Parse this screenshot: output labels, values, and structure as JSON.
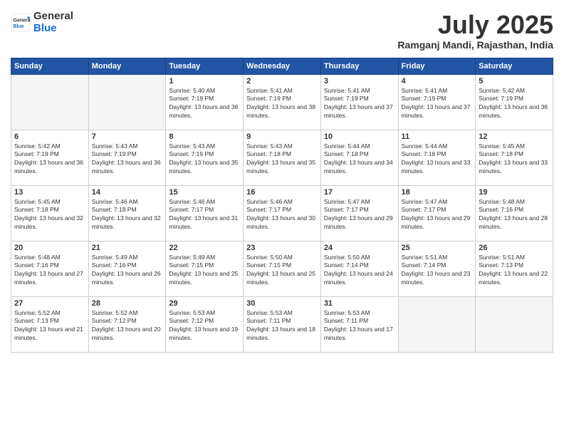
{
  "header": {
    "logo_general": "General",
    "logo_blue": "Blue",
    "month_year": "July 2025",
    "location": "Ramganj Mandi, Rajasthan, India"
  },
  "days_of_week": [
    "Sunday",
    "Monday",
    "Tuesday",
    "Wednesday",
    "Thursday",
    "Friday",
    "Saturday"
  ],
  "weeks": [
    [
      {
        "day": "",
        "info": ""
      },
      {
        "day": "",
        "info": ""
      },
      {
        "day": "1",
        "info": "Sunrise: 5:40 AM\nSunset: 7:19 PM\nDaylight: 13 hours and 38 minutes."
      },
      {
        "day": "2",
        "info": "Sunrise: 5:41 AM\nSunset: 7:19 PM\nDaylight: 13 hours and 38 minutes."
      },
      {
        "day": "3",
        "info": "Sunrise: 5:41 AM\nSunset: 7:19 PM\nDaylight: 13 hours and 37 minutes."
      },
      {
        "day": "4",
        "info": "Sunrise: 5:41 AM\nSunset: 7:19 PM\nDaylight: 13 hours and 37 minutes."
      },
      {
        "day": "5",
        "info": "Sunrise: 5:42 AM\nSunset: 7:19 PM\nDaylight: 13 hours and 36 minutes."
      }
    ],
    [
      {
        "day": "6",
        "info": "Sunrise: 5:42 AM\nSunset: 7:19 PM\nDaylight: 13 hours and 36 minutes."
      },
      {
        "day": "7",
        "info": "Sunrise: 5:43 AM\nSunset: 7:19 PM\nDaylight: 13 hours and 36 minutes."
      },
      {
        "day": "8",
        "info": "Sunrise: 5:43 AM\nSunset: 7:19 PM\nDaylight: 13 hours and 35 minutes."
      },
      {
        "day": "9",
        "info": "Sunrise: 5:43 AM\nSunset: 7:18 PM\nDaylight: 13 hours and 35 minutes."
      },
      {
        "day": "10",
        "info": "Sunrise: 5:44 AM\nSunset: 7:18 PM\nDaylight: 13 hours and 34 minutes."
      },
      {
        "day": "11",
        "info": "Sunrise: 5:44 AM\nSunset: 7:18 PM\nDaylight: 13 hours and 33 minutes."
      },
      {
        "day": "12",
        "info": "Sunrise: 5:45 AM\nSunset: 7:18 PM\nDaylight: 13 hours and 33 minutes."
      }
    ],
    [
      {
        "day": "13",
        "info": "Sunrise: 5:45 AM\nSunset: 7:18 PM\nDaylight: 13 hours and 32 minutes."
      },
      {
        "day": "14",
        "info": "Sunrise: 5:46 AM\nSunset: 7:18 PM\nDaylight: 13 hours and 32 minutes."
      },
      {
        "day": "15",
        "info": "Sunrise: 5:46 AM\nSunset: 7:17 PM\nDaylight: 13 hours and 31 minutes."
      },
      {
        "day": "16",
        "info": "Sunrise: 5:46 AM\nSunset: 7:17 PM\nDaylight: 13 hours and 30 minutes."
      },
      {
        "day": "17",
        "info": "Sunrise: 5:47 AM\nSunset: 7:17 PM\nDaylight: 13 hours and 29 minutes."
      },
      {
        "day": "18",
        "info": "Sunrise: 5:47 AM\nSunset: 7:17 PM\nDaylight: 13 hours and 29 minutes."
      },
      {
        "day": "19",
        "info": "Sunrise: 5:48 AM\nSunset: 7:16 PM\nDaylight: 13 hours and 28 minutes."
      }
    ],
    [
      {
        "day": "20",
        "info": "Sunrise: 5:48 AM\nSunset: 7:16 PM\nDaylight: 13 hours and 27 minutes."
      },
      {
        "day": "21",
        "info": "Sunrise: 5:49 AM\nSunset: 7:16 PM\nDaylight: 13 hours and 26 minutes."
      },
      {
        "day": "22",
        "info": "Sunrise: 5:49 AM\nSunset: 7:15 PM\nDaylight: 13 hours and 25 minutes."
      },
      {
        "day": "23",
        "info": "Sunrise: 5:50 AM\nSunset: 7:15 PM\nDaylight: 13 hours and 25 minutes."
      },
      {
        "day": "24",
        "info": "Sunrise: 5:50 AM\nSunset: 7:14 PM\nDaylight: 13 hours and 24 minutes."
      },
      {
        "day": "25",
        "info": "Sunrise: 5:51 AM\nSunset: 7:14 PM\nDaylight: 13 hours and 23 minutes."
      },
      {
        "day": "26",
        "info": "Sunrise: 5:51 AM\nSunset: 7:13 PM\nDaylight: 13 hours and 22 minutes."
      }
    ],
    [
      {
        "day": "27",
        "info": "Sunrise: 5:52 AM\nSunset: 7:13 PM\nDaylight: 13 hours and 21 minutes."
      },
      {
        "day": "28",
        "info": "Sunrise: 5:52 AM\nSunset: 7:12 PM\nDaylight: 13 hours and 20 minutes."
      },
      {
        "day": "29",
        "info": "Sunrise: 5:53 AM\nSunset: 7:12 PM\nDaylight: 13 hours and 19 minutes."
      },
      {
        "day": "30",
        "info": "Sunrise: 5:53 AM\nSunset: 7:11 PM\nDaylight: 13 hours and 18 minutes."
      },
      {
        "day": "31",
        "info": "Sunrise: 5:53 AM\nSunset: 7:11 PM\nDaylight: 13 hours and 17 minutes."
      },
      {
        "day": "",
        "info": ""
      },
      {
        "day": "",
        "info": ""
      }
    ]
  ]
}
